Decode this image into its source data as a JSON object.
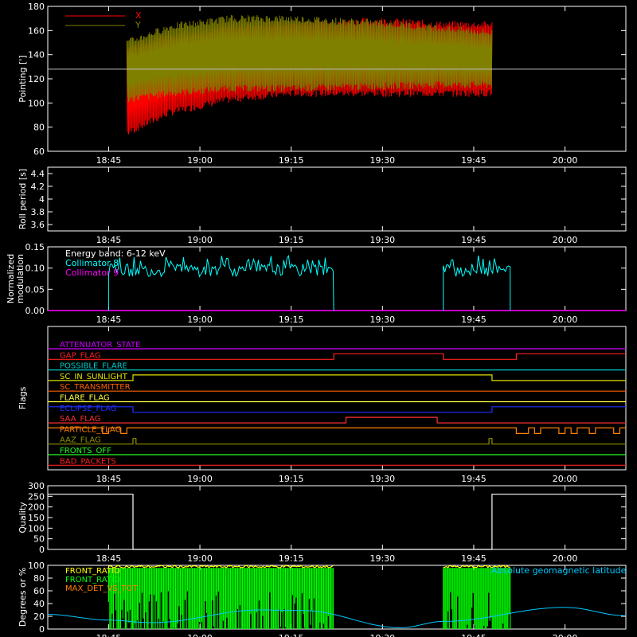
{
  "time_axis": {
    "start": "18:35",
    "end": "20:10",
    "ticks": [
      "18:45",
      "19:00",
      "19:15",
      "19:30",
      "19:45",
      "20:00"
    ]
  },
  "chart_data": [
    {
      "type": "line",
      "ylabel": "Pointing [']",
      "ylim": [
        60,
        180
      ],
      "yticks": [
        60,
        80,
        100,
        120,
        140,
        160,
        180
      ],
      "legend": [
        {
          "name": "X",
          "color": "#ff0000"
        },
        {
          "name": "Y",
          "color": "#808000"
        }
      ],
      "reference_y": 128,
      "data_start": "18:48",
      "data_end": "19:48",
      "series": [
        {
          "name": "X",
          "color": "#ff0000",
          "lower": [
            [
              "18:48",
              75
            ],
            [
              "18:55",
              92
            ],
            [
              "19:05",
              103
            ],
            [
              "19:15",
              108
            ],
            [
              "19:30",
              108
            ],
            [
              "19:40",
              108
            ],
            [
              "19:48",
              108
            ]
          ],
          "upper": [
            [
              "18:48",
              145
            ],
            [
              "18:55",
              155
            ],
            [
              "19:05",
              163
            ],
            [
              "19:15",
              166
            ],
            [
              "19:30",
              168
            ],
            [
              "19:40",
              165
            ],
            [
              "19:48",
              165
            ]
          ]
        },
        {
          "name": "Y",
          "color": "#808000",
          "lower": [
            [
              "18:48",
              103
            ],
            [
              "18:55",
              108
            ],
            [
              "19:05",
              112
            ],
            [
              "19:15",
              112
            ],
            [
              "19:30",
              114
            ],
            [
              "19:40",
              115
            ],
            [
              "19:48",
              115
            ]
          ],
          "upper": [
            [
              "18:48",
              150
            ],
            [
              "18:55",
              163
            ],
            [
              "19:05",
              170
            ],
            [
              "19:15",
              170
            ],
            [
              "19:30",
              166
            ],
            [
              "19:40",
              162
            ],
            [
              "19:48",
              158
            ]
          ]
        }
      ]
    },
    {
      "type": "line",
      "ylabel": "Roll period [s]",
      "ylim": [
        3.5,
        4.5
      ],
      "yticks": [
        3.6,
        3.8,
        4.0,
        4.2,
        4.4
      ]
    },
    {
      "type": "line",
      "ylabel_lines": [
        "Normalized",
        "modulation"
      ],
      "ylim": [
        0,
        0.15
      ],
      "yticks": [
        "0.00",
        "0.05",
        "0.10",
        "0.15"
      ],
      "annotation": "Energy band: 6-12 keV",
      "legend": [
        {
          "name": "Collimator 8",
          "color": "#00ffff"
        },
        {
          "name": "Collimator 9",
          "color": "#ff00ff"
        }
      ],
      "series": [
        {
          "name": "Collimator 8",
          "color": "#00ffff",
          "segments": [
            [
              "18:45",
              "19:22",
              0.095
            ],
            [
              "19:40",
              "19:51",
              0.095
            ]
          ]
        },
        {
          "name": "Collimator 9",
          "color": "#ff00ff",
          "constant": 0
        }
      ]
    },
    {
      "type": "flags",
      "ylabel": "Flags",
      "flags": [
        {
          "name": "ATTENUATOR_STATE",
          "color": "#cc00ff",
          "steps": [
            [
              "18:35",
              0
            ]
          ]
        },
        {
          "name": "GAP_FLAG",
          "color": "#ff2020",
          "steps": [
            [
              "18:35",
              0
            ],
            [
              "19:22",
              1
            ],
            [
              "19:40",
              0
            ],
            [
              "19:52",
              1
            ]
          ]
        },
        {
          "name": "POSSIBLE_FLARE",
          "color": "#00c8c8",
          "steps": [
            [
              "18:35",
              0
            ]
          ]
        },
        {
          "name": "SC_IN_SUNLIGHT",
          "color": "#e0e000",
          "steps": [
            [
              "18:35",
              0
            ],
            [
              "18:49",
              1
            ],
            [
              "19:48",
              0
            ]
          ]
        },
        {
          "name": "SC_TRANSMITTER",
          "color": "#ff6000",
          "steps": [
            [
              "18:35",
              0
            ]
          ]
        },
        {
          "name": "FLARE_FLAG",
          "color": "#ffff40",
          "steps": [
            [
              "18:35",
              0
            ]
          ]
        },
        {
          "name": "ECLIPSE_FLAG",
          "color": "#2030ff",
          "steps": [
            [
              "18:35",
              1
            ],
            [
              "18:49",
              0
            ],
            [
              "19:48",
              1
            ]
          ]
        },
        {
          "name": "SAA_FLAG",
          "color": "#ff3030",
          "steps": [
            [
              "18:35",
              0
            ],
            [
              "19:24",
              1
            ],
            [
              "19:39",
              0
            ]
          ]
        },
        {
          "name": "PARTICLE_FLAG",
          "color": "#ff8000",
          "steps": [
            [
              "18:35",
              1
            ],
            [
              "18:44",
              0
            ],
            [
              "18:45",
              1
            ],
            [
              "18:47",
              0
            ],
            [
              "18:48",
              1
            ],
            [
              "19:52",
              0
            ],
            [
              "19:54",
              1
            ],
            [
              "19:55",
              0
            ],
            [
              "19:56",
              1
            ],
            [
              "19:59",
              0
            ],
            [
              "20:00",
              1
            ],
            [
              "20:01",
              0
            ],
            [
              "20:02",
              1
            ],
            [
              "20:04",
              0
            ],
            [
              "20:05",
              1
            ],
            [
              "20:08",
              0
            ],
            [
              "20:09",
              1
            ]
          ]
        },
        {
          "name": "AAZ_FLAG",
          "color": "#909000",
          "steps": [
            [
              "18:35",
              0
            ],
            [
              "18:49",
              1
            ],
            [
              "18:49.5",
              0
            ],
            [
              "19:47.5",
              1
            ],
            [
              "19:48",
              0
            ]
          ]
        },
        {
          "name": "FRONTS_OFF",
          "color": "#20ff20",
          "steps": [
            [
              "18:35",
              0
            ]
          ]
        },
        {
          "name": "BAD_PACKETS",
          "color": "#ff2020",
          "steps": [
            [
              "18:35",
              0
            ]
          ]
        }
      ]
    },
    {
      "type": "line",
      "ylabel": "Quality",
      "ylim": [
        0,
        300
      ],
      "yticks": [
        0,
        50,
        100,
        150,
        200,
        250,
        300
      ],
      "series": [
        {
          "name": "",
          "color": "#ffffff",
          "steps": [
            [
              "18:35",
              260
            ],
            [
              "18:49",
              0
            ],
            [
              "19:48",
              260
            ]
          ]
        }
      ]
    },
    {
      "type": "line",
      "ylabel": "Degrees or %",
      "ylim": [
        0,
        100
      ],
      "yticks": [
        0,
        20,
        40,
        60,
        80,
        100
      ],
      "legend": [
        {
          "name": "FRONT_RATIO",
          "color": "#ffff00"
        },
        {
          "name": "FRONT_RATIO",
          "color": "#00ff00"
        },
        {
          "name": "MAX_DET_VS_TOT",
          "color": "#ff8000"
        }
      ],
      "right_label": {
        "text": "Absolute geomagnetic latitude",
        "color": "#00c8ff"
      },
      "fill_intervals": [
        [
          "18:45",
          "19:22"
        ],
        [
          "19:40",
          "19:51"
        ]
      ],
      "latitude": [
        [
          "18:35",
          23
        ],
        [
          "18:45",
          14
        ],
        [
          "18:52",
          10
        ],
        [
          "19:10",
          30
        ],
        [
          "19:17",
          29
        ],
        [
          "19:33",
          2
        ],
        [
          "19:40",
          12
        ],
        [
          "20:00",
          34
        ],
        [
          "20:10",
          21
        ]
      ]
    }
  ]
}
